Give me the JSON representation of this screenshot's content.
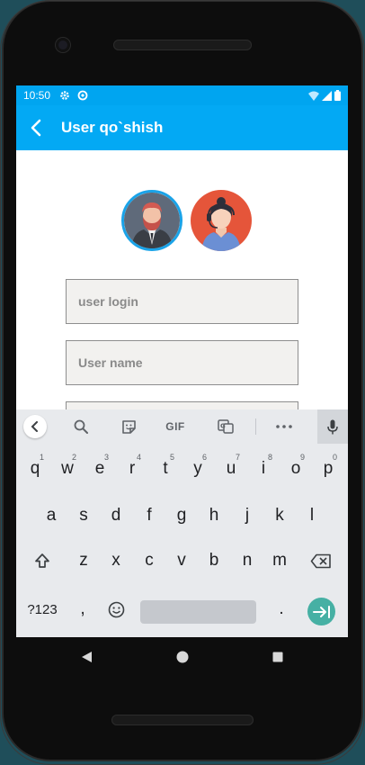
{
  "status_bar": {
    "time": "10:50",
    "icons": [
      "settings-icon",
      "sync-icon",
      "wifi-icon",
      "signal-icon",
      "battery-icon"
    ]
  },
  "app_bar": {
    "title": "User qo`shish",
    "back_icon": "chevron-left-icon",
    "background": "#03a9f4"
  },
  "avatars": [
    {
      "name": "male-avatar",
      "ring_color": "#1aa3e8",
      "bg": "#5f6a7a"
    },
    {
      "name": "female-avatar",
      "bg": "#e5553a"
    }
  ],
  "form": {
    "login_placeholder": "user login",
    "name_placeholder": "User name",
    "login_value": "",
    "name_value": ""
  },
  "keyboard": {
    "toolbar": {
      "gif_label": "GIF",
      "icons": [
        "chevron-left-icon",
        "search-icon",
        "sticker-icon",
        "translate-icon",
        "more-icon",
        "mic-icon"
      ]
    },
    "row1": [
      {
        "k": "q",
        "h": "1"
      },
      {
        "k": "w",
        "h": "2"
      },
      {
        "k": "e",
        "h": "3"
      },
      {
        "k": "r",
        "h": "4"
      },
      {
        "k": "t",
        "h": "5"
      },
      {
        "k": "y",
        "h": "6"
      },
      {
        "k": "u",
        "h": "7"
      },
      {
        "k": "i",
        "h": "8"
      },
      {
        "k": "o",
        "h": "9"
      },
      {
        "k": "p",
        "h": "0"
      }
    ],
    "row2": [
      "a",
      "s",
      "d",
      "f",
      "g",
      "h",
      "j",
      "k",
      "l"
    ],
    "row3": [
      "z",
      "x",
      "c",
      "v",
      "b",
      "n",
      "m"
    ],
    "symbols_label": "?123",
    "comma": ",",
    "period": ".",
    "enter_color": "#46b0a4"
  }
}
